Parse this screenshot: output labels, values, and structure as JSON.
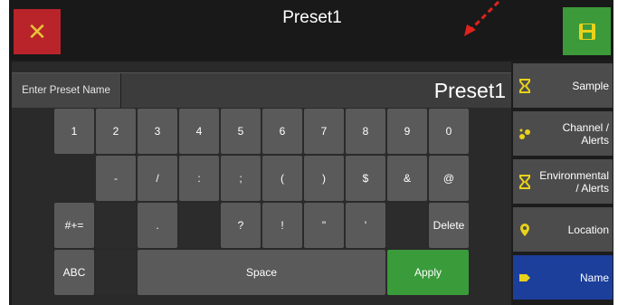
{
  "header": {
    "title": "Preset1",
    "close_icon": "close-icon",
    "save_icon": "floppy-disk-icon"
  },
  "name_entry": {
    "label": "Enter Preset Name",
    "value": "Preset1"
  },
  "keyboard": {
    "row1": [
      "1",
      "2",
      "3",
      "4",
      "5",
      "6",
      "7",
      "8",
      "9",
      "0"
    ],
    "row2": [
      "-",
      "/",
      ":",
      ";",
      "(",
      ")",
      "$",
      "&",
      "@"
    ],
    "row3": [
      "#+=",
      ".",
      "?",
      "!",
      "\"",
      "'",
      "Delete"
    ],
    "row4": [
      "ABC",
      "Space",
      "Apply"
    ]
  },
  "sidebar": {
    "items": [
      {
        "label": "Sample",
        "icon": "hourglass-icon"
      },
      {
        "label": "Channel /\nAlerts",
        "icon": "sensor-dots-icon"
      },
      {
        "label": "Environmental\n/ Alerts",
        "icon": "hourglass-icon"
      },
      {
        "label": "Location",
        "icon": "map-pin-icon"
      },
      {
        "label": "Name",
        "icon": "tag-icon"
      }
    ]
  },
  "colors": {
    "close": "#b8242a",
    "save": "#3c9a3a",
    "apply": "#3a9b3a",
    "active": "#1c3f9c",
    "icon": "#e9d21a"
  }
}
